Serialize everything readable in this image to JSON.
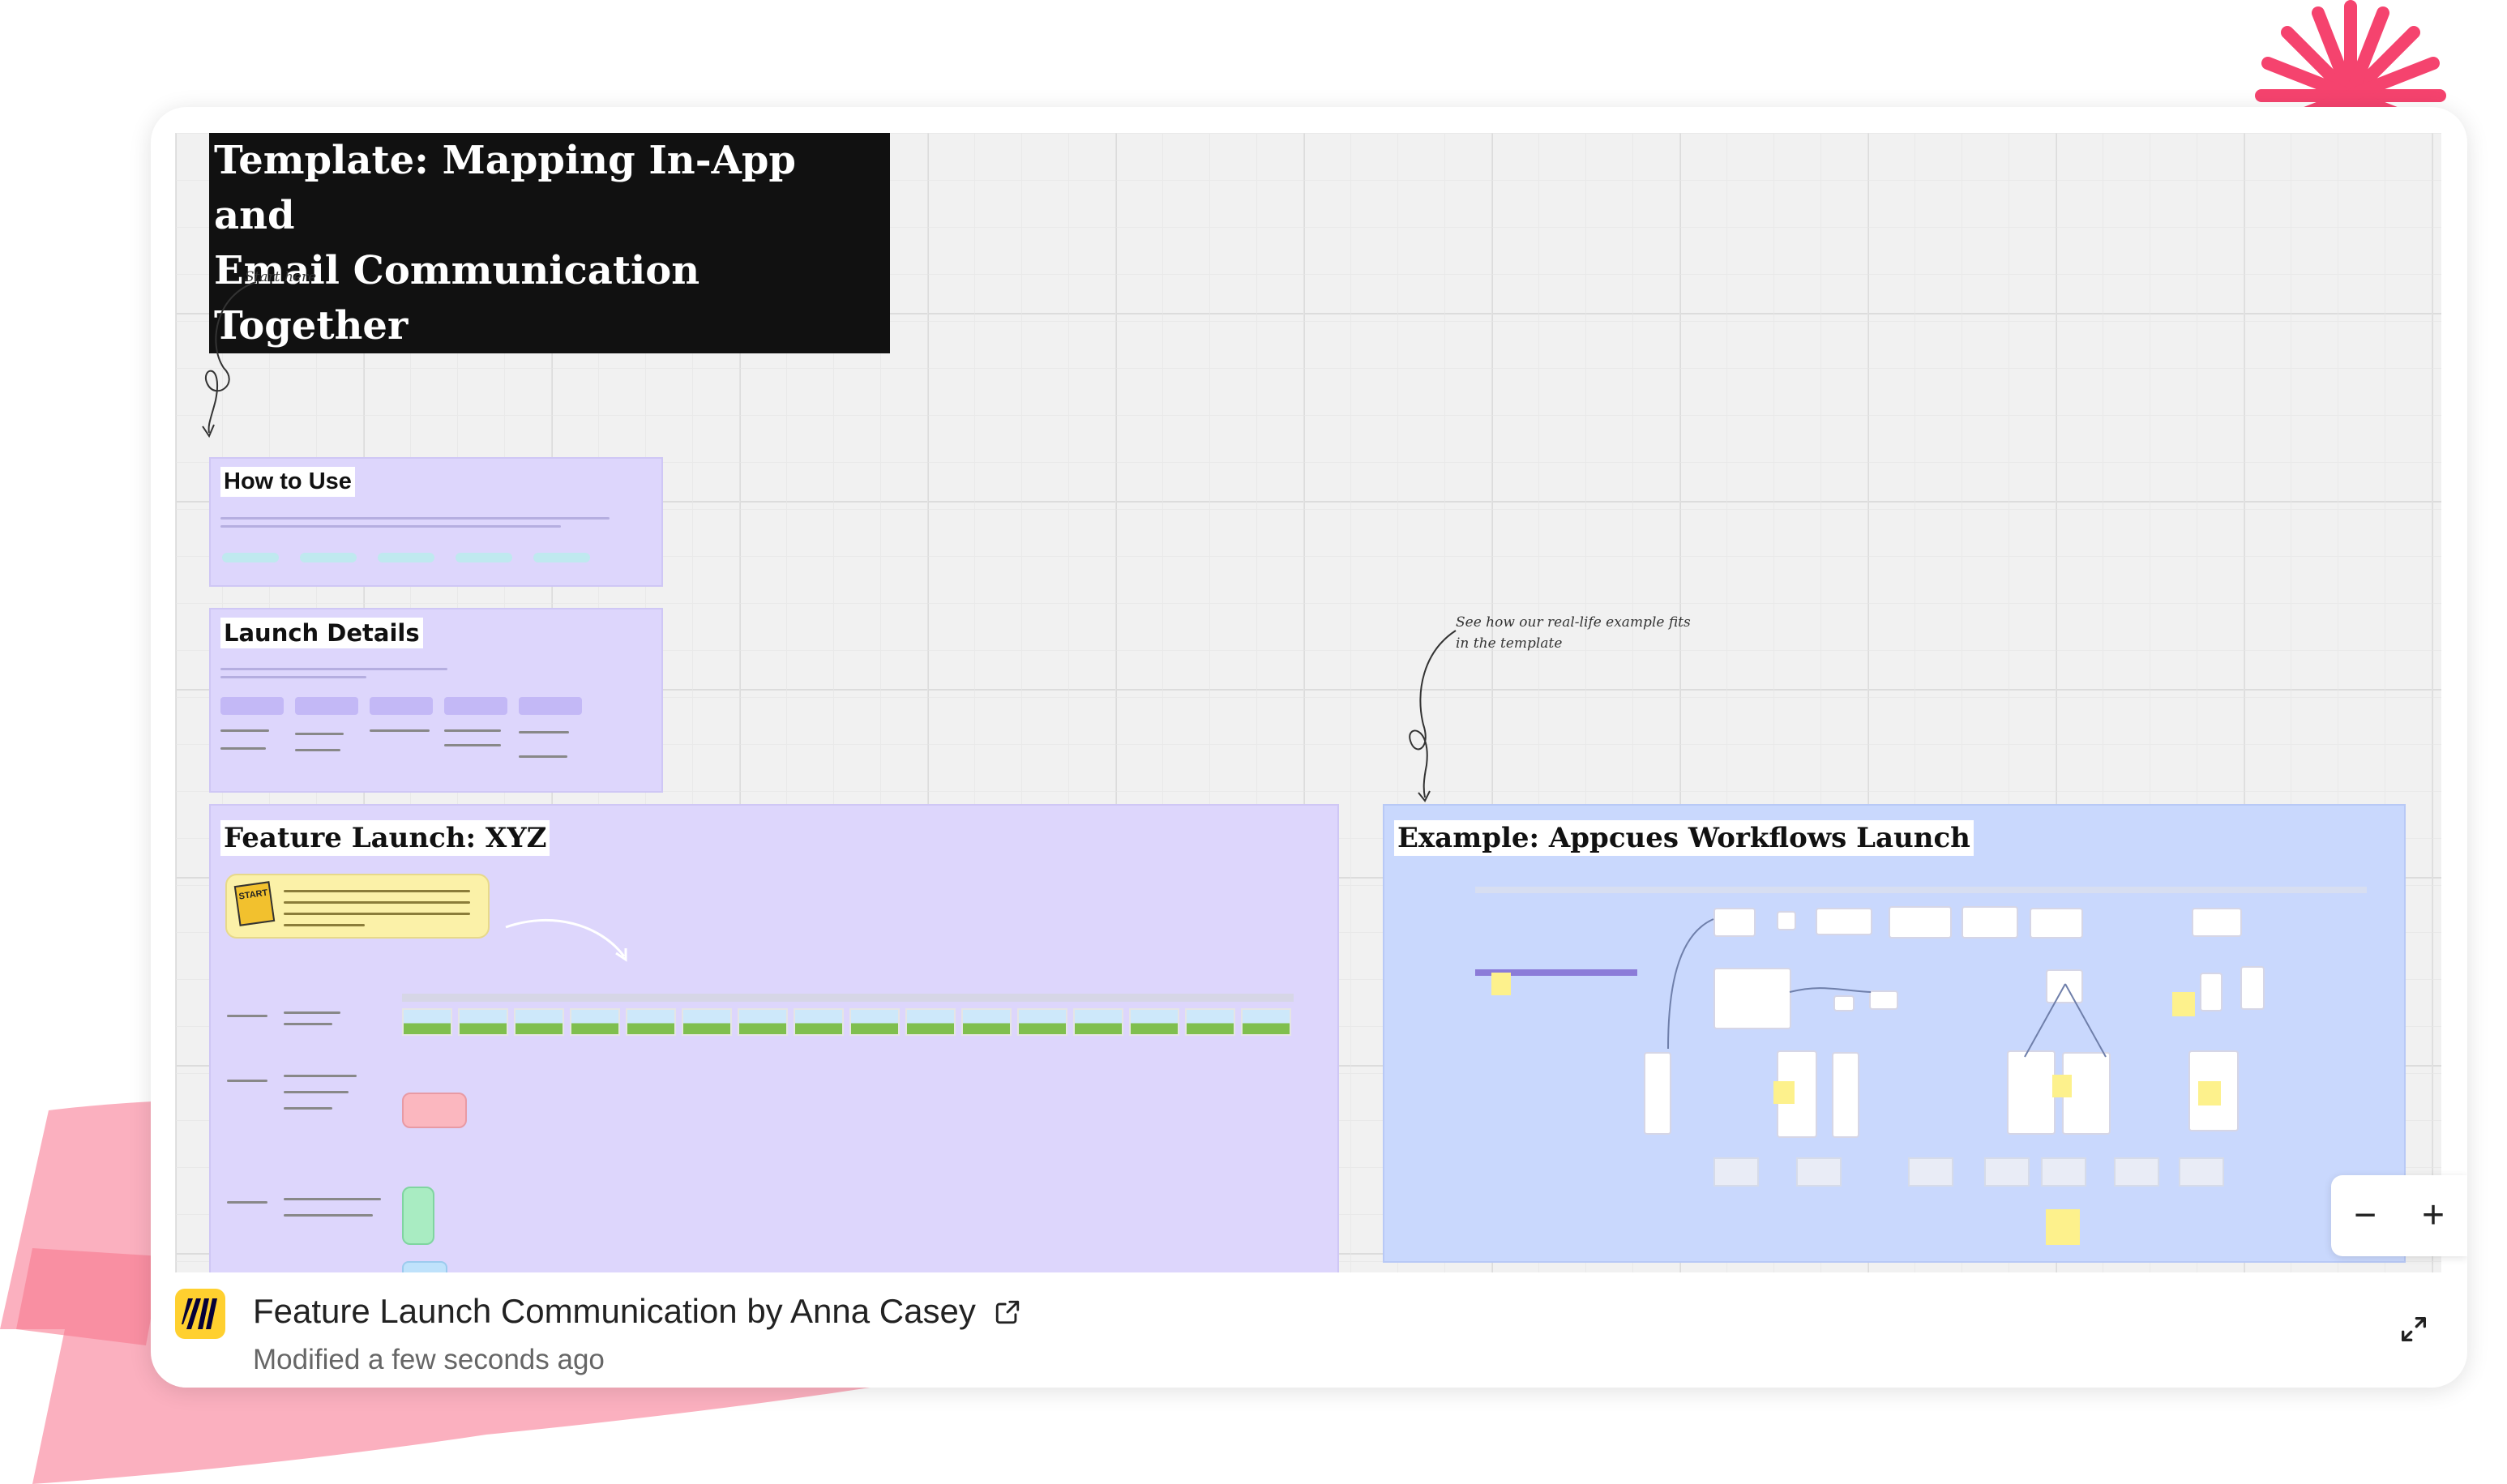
{
  "board": {
    "title_line1": "Template: Mapping In-App and",
    "title_line2": "Email Communication Together",
    "note_start": "Start here",
    "note_example_line1": "See how our real-life example fits",
    "note_example_line2": "in the template",
    "frames": {
      "how_to_use": "How to Use",
      "launch_details": "Launch Details",
      "feature_launch": "Feature Launch: XYZ",
      "example": "Example: Appcues Workflows Launch"
    },
    "start_flag": "START"
  },
  "zoom": {
    "out_label": "−",
    "in_label": "+"
  },
  "footer": {
    "board_name": "Feature Launch Communication by Anna Casey",
    "modified": "Modified a few seconds ago"
  },
  "colors": {
    "accent_pink": "#f5436e",
    "frame_purple": "#ddd6fc",
    "frame_blue": "#c9d8fd",
    "miro_yellow": "#ffd02f"
  }
}
